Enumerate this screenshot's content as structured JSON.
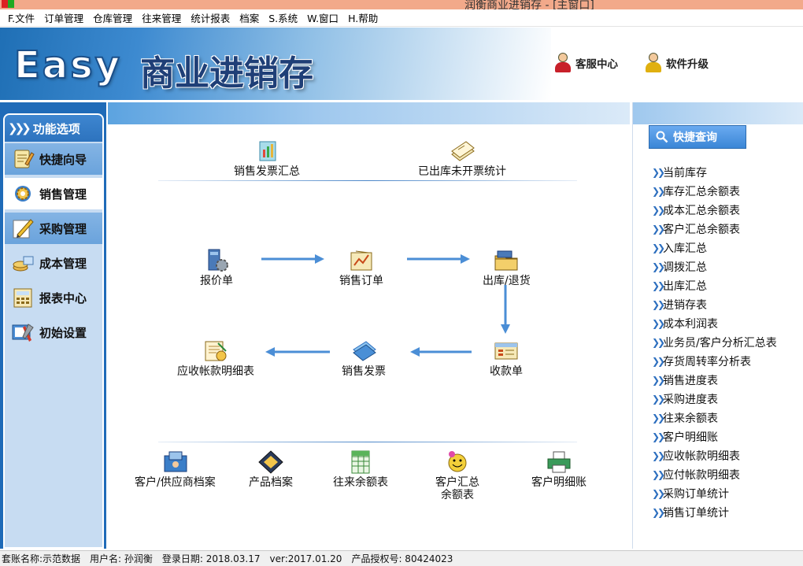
{
  "titlebar": {
    "title": "润衡商业进销存 - [主窗口]"
  },
  "menu": [
    "F.文件",
    "订单管理",
    "仓库管理",
    "往来管理",
    "统计报表",
    "档案",
    "S.系统",
    "W.窗口",
    "H.帮助"
  ],
  "banner": {
    "logo_latin": "Easy",
    "logo_cn": "商业进销存",
    "service_label": "客服中心",
    "upgrade_label": "软件升级"
  },
  "sidebar": {
    "header": "功能选项",
    "items": [
      {
        "label": "快捷向导",
        "icon": "wizard-icon"
      },
      {
        "label": "销售管理",
        "icon": "sales-gear-icon"
      },
      {
        "label": "采购管理",
        "icon": "pen-paper-icon"
      },
      {
        "label": "成本管理",
        "icon": "coins-icon"
      },
      {
        "label": "报表中心",
        "icon": "calculator-icon"
      },
      {
        "label": "初始设置",
        "icon": "tools-icon"
      }
    ],
    "selected": "销售管理"
  },
  "center": {
    "top_links": [
      {
        "label": "销售发票汇总",
        "icon": "invoice-chart-icon"
      },
      {
        "label": "已出库未开票统计",
        "icon": "paper-stack-icon"
      }
    ],
    "flow": {
      "quote": "报价单",
      "sales_order": "销售订单",
      "outbound": "出库/退货",
      "receipt": "收款单",
      "sales_invoice": "销售发票",
      "receivable_detail": "应收帐款明细表"
    },
    "bottom_links": [
      {
        "label": "客户/供应商档案",
        "icon": "customer-file-icon"
      },
      {
        "label": "产品档案",
        "icon": "product-file-icon"
      },
      {
        "label": "往来余额表",
        "icon": "spreadsheet-icon"
      },
      {
        "label": "客户汇总",
        "label2": "余额表",
        "icon": "smiley-icon"
      },
      {
        "label": "客户明细账",
        "icon": "printer-icon"
      }
    ]
  },
  "quick": {
    "button": "快捷查询",
    "items": [
      "当前库存",
      "库存汇总余额表",
      "成本汇总余额表",
      "客户汇总余额表",
      "入库汇总",
      "调拨汇总",
      "出库汇总",
      "进销存表",
      "成本利润表",
      "业务员/客户分析汇总表",
      "存货周转率分析表",
      "销售进度表",
      "采购进度表",
      "往来余额表",
      "客户明细账",
      "应收帐款明细表",
      "应付帐款明细表",
      "采购订单统计",
      "销售订单统计"
    ]
  },
  "status": {
    "account": "套账名称:示范数据",
    "user": "用户名: 孙润衡",
    "login_date": "登录日期: 2018.03.17",
    "version": "ver:2017.01.20",
    "license": "产品授权号: 80424023"
  }
}
